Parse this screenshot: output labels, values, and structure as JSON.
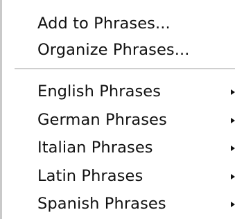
{
  "menu": {
    "top_items": [
      {
        "label": "Add to Phrases..."
      },
      {
        "label": "Organize Phrases..."
      }
    ],
    "submenu_items": [
      {
        "label": "English Phrases",
        "has_submenu": true
      },
      {
        "label": "German Phrases",
        "has_submenu": true
      },
      {
        "label": "Italian Phrases",
        "has_submenu": true
      },
      {
        "label": "Latin Phrases",
        "has_submenu": true
      },
      {
        "label": "Spanish Phrases",
        "has_submenu": true
      }
    ]
  },
  "colors": {
    "background": "#ffffff",
    "text": "#111111",
    "separator": "#cfcfcf",
    "left_edge": "#c9c9c9"
  }
}
